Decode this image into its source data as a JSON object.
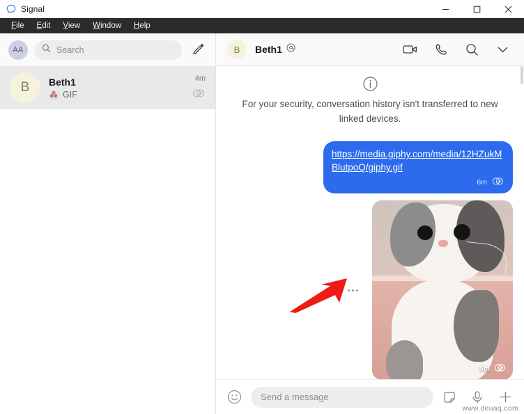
{
  "window": {
    "title": "Signal",
    "logo_icon": "signal-logo-icon",
    "controls": {
      "minimize": "minimize-icon",
      "maximize": "maximize-icon",
      "close": "close-icon"
    }
  },
  "menubar": {
    "items": [
      {
        "label": "File",
        "accel": "F"
      },
      {
        "label": "Edit",
        "accel": "E"
      },
      {
        "label": "View",
        "accel": "V"
      },
      {
        "label": "Window",
        "accel": "W"
      },
      {
        "label": "Help",
        "accel": "H"
      }
    ]
  },
  "sidebar": {
    "me_avatar_initials": "AA",
    "search": {
      "placeholder": "Search",
      "value": "",
      "icon": "search-icon"
    },
    "compose_icon": "pencil-compose-icon",
    "conversations": [
      {
        "avatar_initial": "B",
        "name": "Beth1",
        "preview": "GIF",
        "preview_icon": "gif-thumbnail-icon",
        "time": "4m",
        "status_icon": "read-receipt-icon",
        "selected": true
      }
    ]
  },
  "conversation": {
    "header": {
      "avatar_initial": "B",
      "title": "Beth1",
      "badge_icon": "at-mention-icon",
      "actions": [
        {
          "name": "video-call-icon",
          "label": "Video call"
        },
        {
          "name": "voice-call-icon",
          "label": "Voice call"
        },
        {
          "name": "search-icon",
          "label": "Search in conversation"
        },
        {
          "name": "chevron-down-icon",
          "label": "Conversation details"
        }
      ]
    },
    "notice": {
      "icon": "info-icon",
      "text": "For your security, conversation history isn't transferred to new linked devices."
    },
    "messages": [
      {
        "type": "text-link",
        "direction": "outgoing",
        "text": "https://media.giphy.com/media/12HZukMBlutpoQ/giphy.gif",
        "time": "6m",
        "status_icon": "read-receipt-icon"
      },
      {
        "type": "media",
        "direction": "outgoing",
        "media_alt": "Animated GIF of a grey and white kitten looking upward",
        "time": "5m",
        "status_icon": "read-receipt-icon",
        "more_options_icon": "more-options-dots-icon"
      }
    ],
    "annotation": {
      "type": "arrow",
      "color": "#ee1c15",
      "points_to": "more-options-dots-icon"
    }
  },
  "composer": {
    "emoji_icon": "emoji-smiley-icon",
    "input": {
      "placeholder": "Send a message",
      "value": ""
    },
    "actions": [
      {
        "name": "sticker-icon",
        "label": "Stickers"
      },
      {
        "name": "microphone-icon",
        "label": "Record voice message"
      },
      {
        "name": "attach-plus-icon",
        "label": "Attach"
      }
    ]
  },
  "watermark": {
    "text": "www.deuaq.com"
  },
  "colors": {
    "accent_blue": "#2c6bed",
    "menubar_bg": "#2b2b2b",
    "selected_row_bg": "#e9e9e9",
    "annotation_red": "#ee1c15"
  }
}
